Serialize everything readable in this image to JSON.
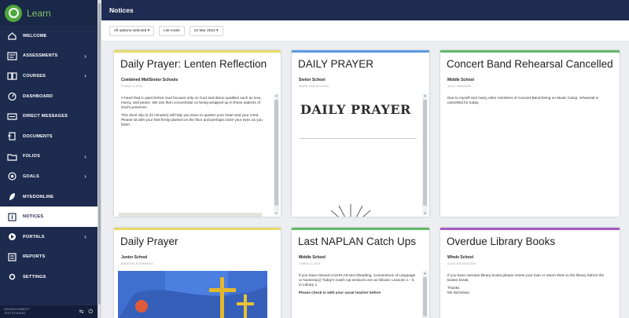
{
  "app": {
    "logo_text": "Learn",
    "page_title": "Notices"
  },
  "sidebar": {
    "items": [
      {
        "label": "WELCOME",
        "icon": "home-icon",
        "chevron": false
      },
      {
        "label": "ASSESSMENTS",
        "icon": "assessments-icon",
        "chevron": true
      },
      {
        "label": "COURSES",
        "icon": "courses-icon",
        "chevron": true
      },
      {
        "label": "DASHBOARD",
        "icon": "dashboard-icon",
        "chevron": false
      },
      {
        "label": "DIRECT MESSAGES",
        "icon": "messages-icon",
        "chevron": false
      },
      {
        "label": "DOCUMENTS",
        "icon": "documents-icon",
        "chevron": false
      },
      {
        "label": "FOLIOS",
        "icon": "folios-icon",
        "chevron": true
      },
      {
        "label": "GOALS",
        "icon": "goals-icon",
        "chevron": true
      },
      {
        "label": "MYEDONLINE",
        "icon": "myedonline-icon",
        "chevron": false
      },
      {
        "label": "NOTICES",
        "icon": "notices-icon",
        "chevron": false,
        "active": true
      },
      {
        "label": "PORTALS",
        "icon": "portals-icon",
        "chevron": true
      },
      {
        "label": "REPORTS",
        "icon": "reports-icon",
        "chevron": false
      },
      {
        "label": "SETTINGS",
        "icon": "settings-icon",
        "chevron": false
      }
    ],
    "user": {
      "name": "ASHISON ABBOTT",
      "sub": "TESTSTUDENT"
    }
  },
  "filters": {
    "options": "All options selected ▾",
    "mode": "List mode",
    "date": "22 Mar 2024 ▾"
  },
  "cards": [
    {
      "title": "Daily Prayer: Lenten Reflection",
      "school": "Combined Mid/Senior Schools",
      "author": "CHRIS LLOYD",
      "accent": "#e9d96a",
      "body": [
        "A heart that is quiet before God focuses only on God and divine qualities such as love, mercy, and peace. We can then concentrate on being wrapped up in those aspects of God's presence.",
        "This short clip (2.33 minutes) will help you learn to quieten your heart and your mind.",
        "Please sit with your feet firmly planted on the floor and perhaps close your eyes as you listen."
      ]
    },
    {
      "title": "DAILY PRAYER",
      "school": "Senior School",
      "author": "MARILYNA WILSON",
      "accent": "#5b9be0",
      "image_text": "DAILY PRAYER"
    },
    {
      "title": "Concert Band Rehearsal Cancelled",
      "school": "Middle School",
      "author": "JACK HEWSON",
      "accent": "#63b86a",
      "body": [
        "Due to myself and many other members of Concert Band being on Music Camp, rehearsal is cancelled for today."
      ]
    },
    {
      "title": "Daily Prayer",
      "school": "Junior School",
      "author": "BIANTHA STEPHENS",
      "accent": "#e9d96a"
    },
    {
      "title": "Last NAPLAN Catch Ups",
      "school": "Middle School",
      "author": "CHRIS LLOYD",
      "accent": "#63b86a",
      "body": [
        "If you have missed a NAPLAN test (Reading, Conventions of Language or Numeracy) Today's Catch Up sessions are as follows: Lessons 1 - 6 in Library 1",
        "Please check in with your usual teacher before"
      ]
    },
    {
      "title": "Overdue Library Books",
      "school": "Whole School",
      "author": "ALEX NICHOLSON",
      "accent": "#a35bc2",
      "body": [
        "If you have overdue library books please renew your loan or return them to the library before the Easter break.",
        "Thanks",
        "Ms Nicholson"
      ]
    }
  ]
}
